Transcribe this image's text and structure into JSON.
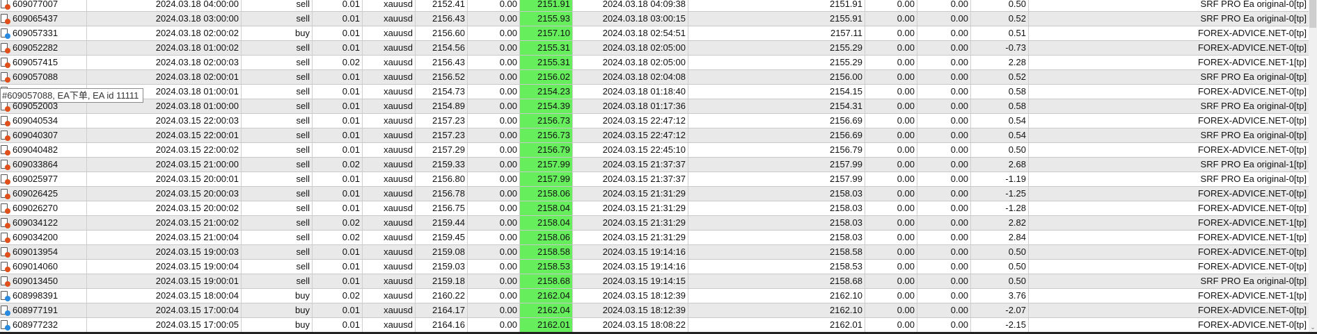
{
  "colors": {
    "tp_highlight": "#66ee5c",
    "sell_dot": "#e0501a",
    "buy_dot": "#2a8ae0"
  },
  "tooltip": "#609057088, EA下单, EA id 11111",
  "rows": [
    {
      "id": "609077007",
      "open_time": "2024.03.18 04:00:00",
      "type": "sell",
      "volume": "0.01",
      "symbol": "xauusd",
      "price": "2152.41",
      "sl": "0.00",
      "tp": "2151.91",
      "close_time": "2024.03.18 04:09:38",
      "close_price": "2151.91",
      "commission": "0.00",
      "swap": "0.00",
      "profit": "0.50",
      "comment": "SRF PRO Ea original-0[tp]"
    },
    {
      "id": "609065437",
      "open_time": "2024.03.18 03:00:00",
      "type": "sell",
      "volume": "0.01",
      "symbol": "xauusd",
      "price": "2156.43",
      "sl": "0.00",
      "tp": "2155.93",
      "close_time": "2024.03.18 03:00:15",
      "close_price": "2155.91",
      "commission": "0.00",
      "swap": "0.00",
      "profit": "0.52",
      "comment": "SRF PRO Ea original-0[tp]"
    },
    {
      "id": "609057331",
      "open_time": "2024.03.18 02:00:02",
      "type": "buy",
      "volume": "0.01",
      "symbol": "xauusd",
      "price": "2156.60",
      "sl": "0.00",
      "tp": "2157.10",
      "close_time": "2024.03.18 02:54:51",
      "close_price": "2157.11",
      "commission": "0.00",
      "swap": "0.00",
      "profit": "0.51",
      "comment": "FOREX-ADVICE.NET-0[tp]"
    },
    {
      "id": "609052282",
      "open_time": "2024.03.18 01:00:02",
      "type": "sell",
      "volume": "0.01",
      "symbol": "xauusd",
      "price": "2154.56",
      "sl": "0.00",
      "tp": "2155.31",
      "close_time": "2024.03.18 02:05:00",
      "close_price": "2155.29",
      "commission": "0.00",
      "swap": "0.00",
      "profit": "-0.73",
      "comment": "FOREX-ADVICE.NET-0[tp]"
    },
    {
      "id": "609057415",
      "open_time": "2024.03.18 02:00:03",
      "type": "sell",
      "volume": "0.02",
      "symbol": "xauusd",
      "price": "2156.43",
      "sl": "0.00",
      "tp": "2155.31",
      "close_time": "2024.03.18 02:05:00",
      "close_price": "2155.29",
      "commission": "0.00",
      "swap": "0.00",
      "profit": "2.28",
      "comment": "FOREX-ADVICE.NET-1[tp]"
    },
    {
      "id": "609057088",
      "open_time": "2024.03.18 02:00:01",
      "type": "sell",
      "volume": "0.01",
      "symbol": "xauusd",
      "price": "2156.52",
      "sl": "0.00",
      "tp": "2156.02",
      "close_time": "2024.03.18 02:04:08",
      "close_price": "2156.00",
      "commission": "0.00",
      "swap": "0.00",
      "profit": "0.52",
      "comment": "SRF PRO Ea original-0[tp]"
    },
    {
      "id": "",
      "open_time": "2024.03.18 01:00:01",
      "type": "sell",
      "volume": "0.01",
      "symbol": "xauusd",
      "price": "2154.73",
      "sl": "0.00",
      "tp": "2154.23",
      "close_time": "2024.03.18 01:18:40",
      "close_price": "2154.15",
      "commission": "0.00",
      "swap": "0.00",
      "profit": "0.58",
      "comment": "FOREX-ADVICE.NET-0[tp]"
    },
    {
      "id": "609052003",
      "open_time": "2024.03.18 01:00:00",
      "type": "sell",
      "volume": "0.01",
      "symbol": "xauusd",
      "price": "2154.89",
      "sl": "0.00",
      "tp": "2154.39",
      "close_time": "2024.03.18 01:17:36",
      "close_price": "2154.31",
      "commission": "0.00",
      "swap": "0.00",
      "profit": "0.58",
      "comment": "SRF PRO Ea original-0[tp]"
    },
    {
      "id": "609040534",
      "open_time": "2024.03.15 22:00:03",
      "type": "sell",
      "volume": "0.01",
      "symbol": "xauusd",
      "price": "2157.23",
      "sl": "0.00",
      "tp": "2156.73",
      "close_time": "2024.03.15 22:47:12",
      "close_price": "2156.69",
      "commission": "0.00",
      "swap": "0.00",
      "profit": "0.54",
      "comment": "FOREX-ADVICE.NET-0[tp]"
    },
    {
      "id": "609040307",
      "open_time": "2024.03.15 22:00:01",
      "type": "sell",
      "volume": "0.01",
      "symbol": "xauusd",
      "price": "2157.23",
      "sl": "0.00",
      "tp": "2156.73",
      "close_time": "2024.03.15 22:47:12",
      "close_price": "2156.69",
      "commission": "0.00",
      "swap": "0.00",
      "profit": "0.54",
      "comment": "SRF PRO Ea original-0[tp]"
    },
    {
      "id": "609040482",
      "open_time": "2024.03.15 22:00:02",
      "type": "sell",
      "volume": "0.01",
      "symbol": "xauusd",
      "price": "2157.29",
      "sl": "0.00",
      "tp": "2156.79",
      "close_time": "2024.03.15 22:45:10",
      "close_price": "2156.79",
      "commission": "0.00",
      "swap": "0.00",
      "profit": "0.50",
      "comment": "FOREX-ADVICE.NET-0[tp]"
    },
    {
      "id": "609033864",
      "open_time": "2024.03.15 21:00:00",
      "type": "sell",
      "volume": "0.02",
      "symbol": "xauusd",
      "price": "2159.33",
      "sl": "0.00",
      "tp": "2157.99",
      "close_time": "2024.03.15 21:37:37",
      "close_price": "2157.99",
      "commission": "0.00",
      "swap": "0.00",
      "profit": "2.68",
      "comment": "SRF PRO Ea original-1[tp]"
    },
    {
      "id": "609025977",
      "open_time": "2024.03.15 20:00:01",
      "type": "sell",
      "volume": "0.01",
      "symbol": "xauusd",
      "price": "2156.80",
      "sl": "0.00",
      "tp": "2157.99",
      "close_time": "2024.03.15 21:37:37",
      "close_price": "2157.99",
      "commission": "0.00",
      "swap": "0.00",
      "profit": "-1.19",
      "comment": "SRF PRO Ea original-0[tp]"
    },
    {
      "id": "609026425",
      "open_time": "2024.03.15 20:00:03",
      "type": "sell",
      "volume": "0.01",
      "symbol": "xauusd",
      "price": "2156.78",
      "sl": "0.00",
      "tp": "2158.06",
      "close_time": "2024.03.15 21:31:29",
      "close_price": "2158.03",
      "commission": "0.00",
      "swap": "0.00",
      "profit": "-1.25",
      "comment": "FOREX-ADVICE.NET-0[tp]"
    },
    {
      "id": "609026270",
      "open_time": "2024.03.15 20:00:02",
      "type": "sell",
      "volume": "0.01",
      "symbol": "xauusd",
      "price": "2156.75",
      "sl": "0.00",
      "tp": "2158.04",
      "close_time": "2024.03.15 21:31:29",
      "close_price": "2158.03",
      "commission": "0.00",
      "swap": "0.00",
      "profit": "-1.28",
      "comment": "FOREX-ADVICE.NET-0[tp]"
    },
    {
      "id": "609034122",
      "open_time": "2024.03.15 21:00:02",
      "type": "sell",
      "volume": "0.02",
      "symbol": "xauusd",
      "price": "2159.44",
      "sl": "0.00",
      "tp": "2158.04",
      "close_time": "2024.03.15 21:31:29",
      "close_price": "2158.03",
      "commission": "0.00",
      "swap": "0.00",
      "profit": "2.82",
      "comment": "FOREX-ADVICE.NET-1[tp]"
    },
    {
      "id": "609034200",
      "open_time": "2024.03.15 21:00:04",
      "type": "sell",
      "volume": "0.02",
      "symbol": "xauusd",
      "price": "2159.45",
      "sl": "0.00",
      "tp": "2158.06",
      "close_time": "2024.03.15 21:31:29",
      "close_price": "2158.03",
      "commission": "0.00",
      "swap": "0.00",
      "profit": "2.84",
      "comment": "FOREX-ADVICE.NET-1[tp]"
    },
    {
      "id": "609013954",
      "open_time": "2024.03.15 19:00:03",
      "type": "sell",
      "volume": "0.01",
      "symbol": "xauusd",
      "price": "2159.08",
      "sl": "0.00",
      "tp": "2158.58",
      "close_time": "2024.03.15 19:14:16",
      "close_price": "2158.58",
      "commission": "0.00",
      "swap": "0.00",
      "profit": "0.50",
      "comment": "FOREX-ADVICE.NET-0[tp]"
    },
    {
      "id": "609014060",
      "open_time": "2024.03.15 19:00:04",
      "type": "sell",
      "volume": "0.01",
      "symbol": "xauusd",
      "price": "2159.03",
      "sl": "0.00",
      "tp": "2158.53",
      "close_time": "2024.03.15 19:14:16",
      "close_price": "2158.53",
      "commission": "0.00",
      "swap": "0.00",
      "profit": "0.50",
      "comment": "FOREX-ADVICE.NET-0[tp]"
    },
    {
      "id": "609013450",
      "open_time": "2024.03.15 19:00:01",
      "type": "sell",
      "volume": "0.01",
      "symbol": "xauusd",
      "price": "2159.18",
      "sl": "0.00",
      "tp": "2158.68",
      "close_time": "2024.03.15 19:14:15",
      "close_price": "2158.68",
      "commission": "0.00",
      "swap": "0.00",
      "profit": "0.50",
      "comment": "SRF PRO Ea original-0[tp]"
    },
    {
      "id": "608998391",
      "open_time": "2024.03.15 18:00:04",
      "type": "buy",
      "volume": "0.02",
      "symbol": "xauusd",
      "price": "2160.22",
      "sl": "0.00",
      "tp": "2162.04",
      "close_time": "2024.03.15 18:12:39",
      "close_price": "2162.10",
      "commission": "0.00",
      "swap": "0.00",
      "profit": "3.76",
      "comment": "FOREX-ADVICE.NET-1[tp]"
    },
    {
      "id": "608977191",
      "open_time": "2024.03.15 17:00:04",
      "type": "buy",
      "volume": "0.01",
      "symbol": "xauusd",
      "price": "2164.17",
      "sl": "0.00",
      "tp": "2162.04",
      "close_time": "2024.03.15 18:12:39",
      "close_price": "2162.10",
      "commission": "0.00",
      "swap": "0.00",
      "profit": "-2.07",
      "comment": "FOREX-ADVICE.NET-0[tp]"
    },
    {
      "id": "608977232",
      "open_time": "2024.03.15 17:00:05",
      "type": "buy",
      "volume": "0.01",
      "symbol": "xauusd",
      "price": "2164.16",
      "sl": "0.00",
      "tp": "2162.01",
      "close_time": "2024.03.15 18:08:22",
      "close_price": "2162.01",
      "commission": "0.00",
      "swap": "0.00",
      "profit": "-2.15",
      "comment": "FOREX-ADVICE.NET-0[tp]"
    }
  ]
}
